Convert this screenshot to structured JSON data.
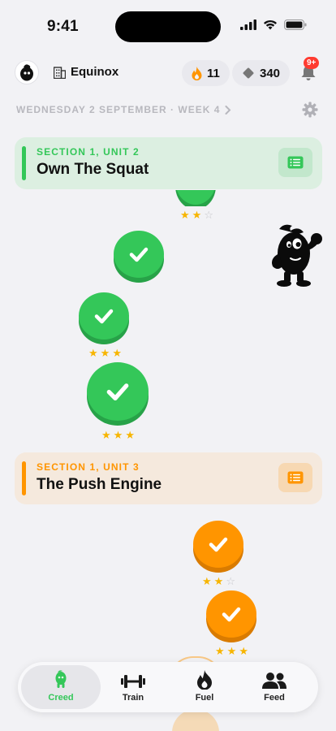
{
  "status_bar": {
    "time": "9:41"
  },
  "header": {
    "gym_name": "Equinox",
    "streak_count": "11",
    "gems_count": "340",
    "notification_badge": "9+"
  },
  "date_row": {
    "text": "WEDNESDAY 2 SEPTEMBER · WEEK 4"
  },
  "sections": [
    {
      "eyebrow": "SECTION 1, UNIT 2",
      "title": "Own The Squat",
      "accent": "#34c759"
    },
    {
      "eyebrow": "SECTION 1, UNIT 3",
      "title": "The Push Engine",
      "accent": "#ff9500"
    }
  ],
  "lessons": [
    {
      "state": "completed",
      "unit": 2,
      "stars": 2,
      "partially_visible": true
    },
    {
      "state": "completed",
      "unit": 2,
      "stars": 0
    },
    {
      "state": "completed",
      "unit": 2,
      "stars": 3
    },
    {
      "state": "completed",
      "unit": 2,
      "stars": 3
    },
    {
      "state": "completed",
      "unit": 3,
      "stars": 2
    },
    {
      "state": "completed",
      "unit": 3,
      "stars": 3
    }
  ],
  "tabs": [
    {
      "label": "Creed",
      "icon": "mascot-icon",
      "active": true
    },
    {
      "label": "Train",
      "icon": "dumbbell-icon",
      "active": false
    },
    {
      "label": "Fuel",
      "icon": "flame-icon",
      "active": false
    },
    {
      "label": "Feed",
      "icon": "people-icon",
      "active": false
    }
  ],
  "colors": {
    "green": "#34c759",
    "orange": "#ff9500",
    "star": "#f7b500",
    "background": "#f2f2f5"
  }
}
